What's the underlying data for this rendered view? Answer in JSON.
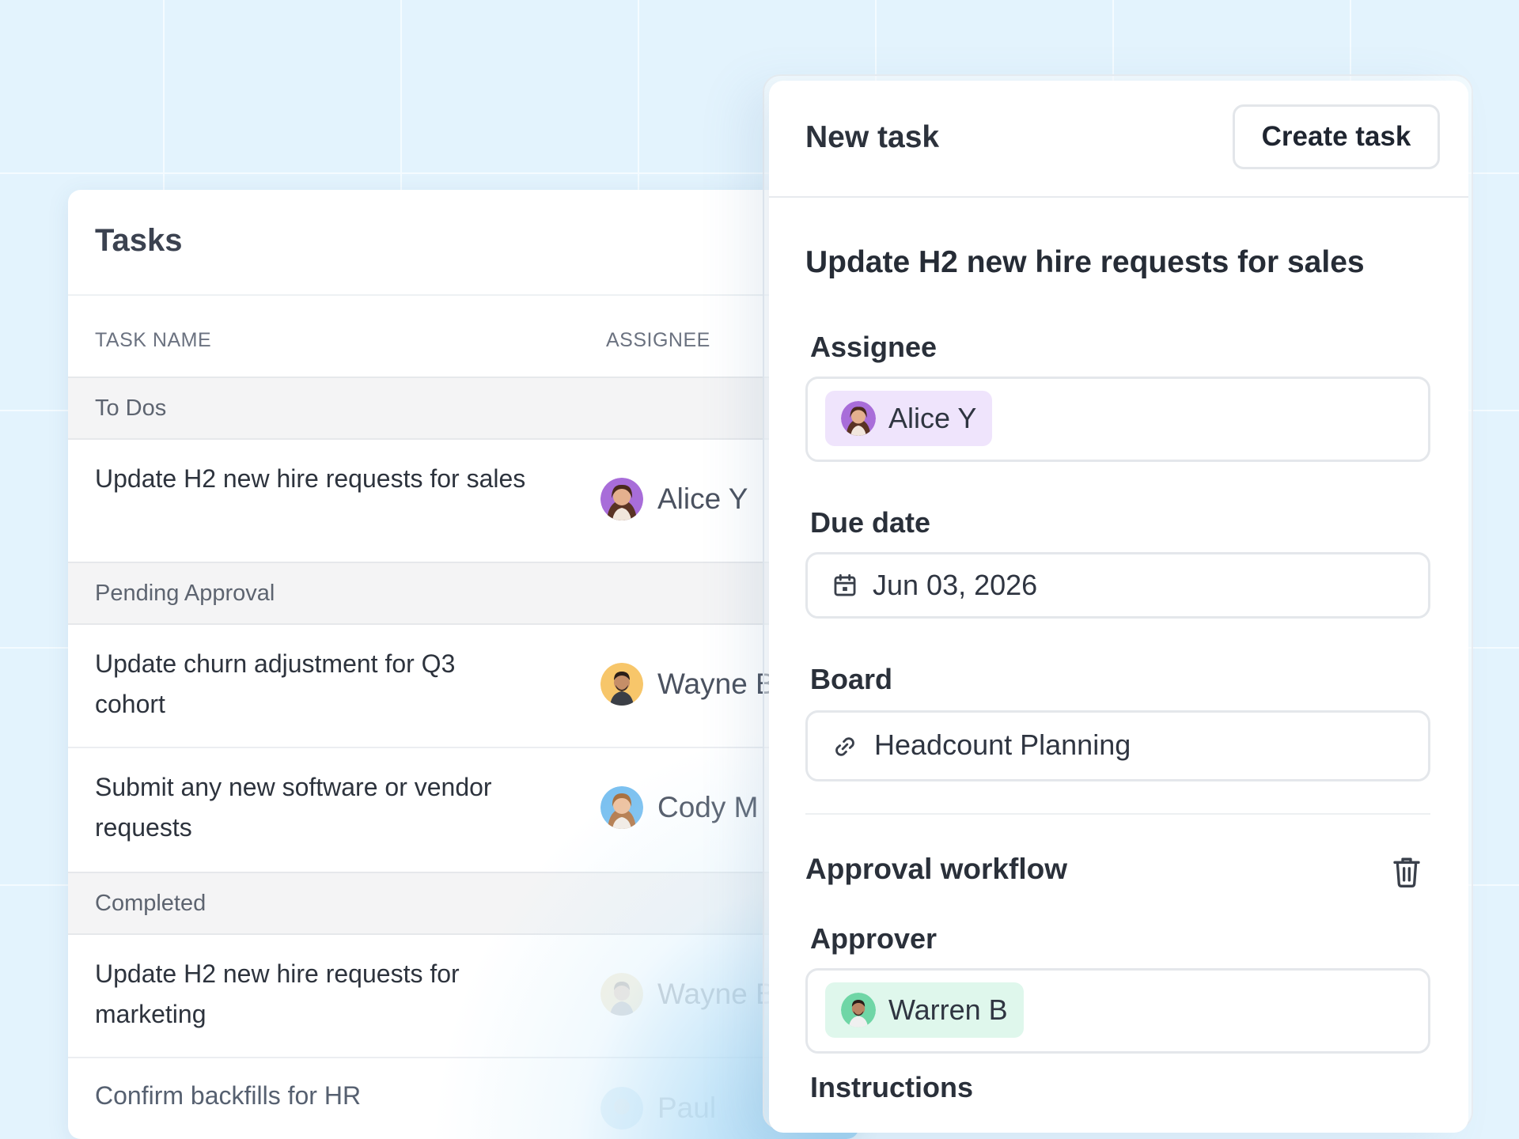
{
  "tasks": {
    "title": "Tasks",
    "columns": {
      "task_name": "TASK NAME",
      "assignee": "ASSIGNEE"
    },
    "sections": [
      {
        "label": "To Dos"
      },
      {
        "label": "Pending Approval"
      },
      {
        "label": "Completed"
      }
    ],
    "rows": [
      {
        "name": "Update H2 new hire requests for sales",
        "assignee": "Alice Y"
      },
      {
        "name": "Update churn adjustment for Q3 cohort",
        "assignee": "Wayne B"
      },
      {
        "name": "Submit any new software or vendor requests",
        "assignee": "Cody M"
      },
      {
        "name": "Update H2 new hire requests for marketing",
        "assignee": "Wayne B"
      },
      {
        "name": "Confirm backfills for HR",
        "assignee": "Paul"
      }
    ]
  },
  "new_task": {
    "title": "New task",
    "create_button": "Create task",
    "task_title": "Update H2 new hire requests for sales",
    "assignee_label": "Assignee",
    "assignee_value": "Alice Y",
    "due_date_label": "Due date",
    "due_date_value": "Jun 03, 2026",
    "board_label": "Board",
    "board_value": "Headcount Planning",
    "approval_workflow_label": "Approval workflow",
    "approver_label": "Approver",
    "approver_value": "Warren B",
    "instructions_label": "Instructions"
  },
  "colors": {
    "background": "#e3f3fd",
    "assignee_chip": "#efe4fc",
    "approver_chip": "#dff7ec"
  },
  "icons": [
    "calendar-icon",
    "link-icon",
    "trash-icon"
  ]
}
